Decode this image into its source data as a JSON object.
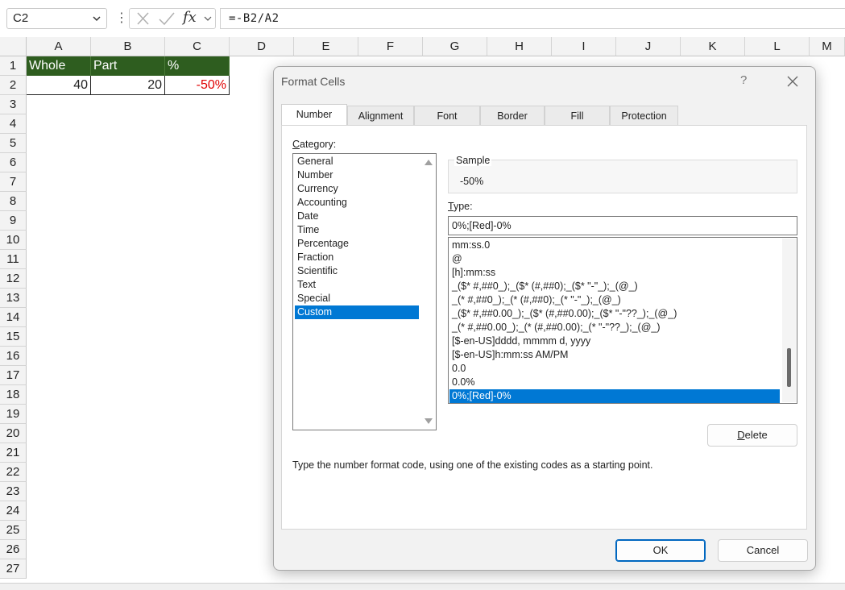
{
  "formula_bar": {
    "name_box": "C2",
    "formula": "=-B2/A2",
    "fx_label": "fx"
  },
  "grid": {
    "columns": [
      "A",
      "B",
      "C",
      "D",
      "E",
      "F",
      "G",
      "H",
      "I",
      "J",
      "K",
      "L",
      "M"
    ],
    "rows": [
      "1",
      "2",
      "3",
      "4",
      "5",
      "6",
      "7",
      "8",
      "9",
      "10",
      "11",
      "12",
      "13",
      "14",
      "15",
      "16",
      "17",
      "18",
      "19",
      "20",
      "21",
      "22",
      "23",
      "24",
      "25",
      "26",
      "27"
    ],
    "cells": {
      "A1": "Whole",
      "B1": "Part",
      "C1": "%",
      "A2": "40",
      "B2": "20",
      "C2": "-50%"
    },
    "header_fill": "#2e5d1f",
    "negative_color": "#e00000"
  },
  "dialog": {
    "title": "Format Cells",
    "help": "?",
    "tabs": [
      "Number",
      "Alignment",
      "Font",
      "Border",
      "Fill",
      "Protection"
    ],
    "active_tab": "Number",
    "category_label": "Category:",
    "categories": [
      "General",
      "Number",
      "Currency",
      "Accounting",
      "Date",
      "Time",
      "Percentage",
      "Fraction",
      "Scientific",
      "Text",
      "Special",
      "Custom"
    ],
    "selected_category": "Custom",
    "sample_label": "Sample",
    "sample_value": "-50%",
    "type_label": "Type:",
    "type_value": "0%;[Red]-0%",
    "type_list": [
      "mm:ss.0",
      "@",
      "[h]:mm:ss",
      "_($* #,##0_);_($* (#,##0);_($* \"-\"_);_(@_)",
      "_(* #,##0_);_(* (#,##0);_(* \"-\"_);_(@_)",
      "_($* #,##0.00_);_($* (#,##0.00);_($* \"-\"??_);_(@_)",
      "_(* #,##0.00_);_(* (#,##0.00);_(* \"-\"??_);_(@_)",
      "[$-en-US]dddd, mmmm d, yyyy",
      "[$-en-US]h:mm:ss AM/PM",
      "0.0",
      "0.0%",
      "0%;[Red]-0%"
    ],
    "delete_label": "Delete",
    "hint": "Type the number format code, using one of the existing codes as a starting point.",
    "ok_label": "OK",
    "cancel_label": "Cancel",
    "accent_color": "#0078d4"
  }
}
